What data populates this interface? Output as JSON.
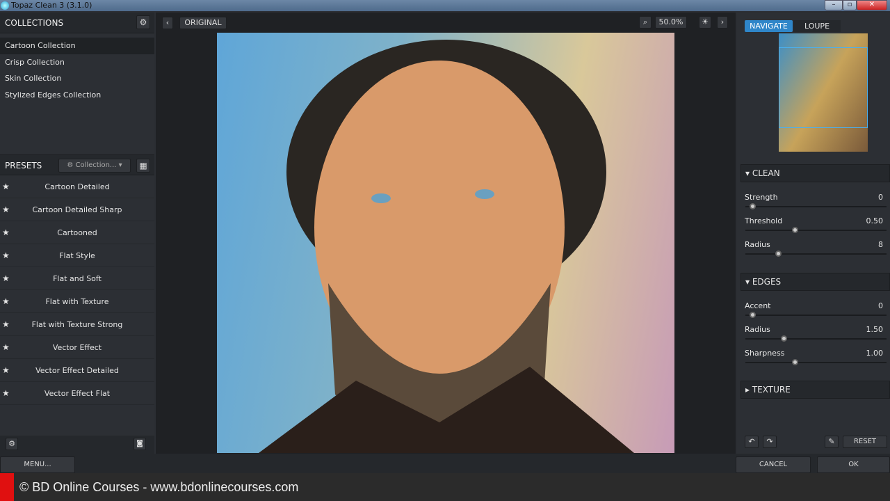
{
  "window": {
    "title": "Topaz Clean 3 (3.1.0)"
  },
  "collections": {
    "header": "COLLECTIONS",
    "items": [
      "Cartoon Collection",
      "Crisp Collection",
      "Skin Collection",
      "Stylized Edges Collection"
    ]
  },
  "presets": {
    "header": "PRESETS",
    "dropdown": "Collection...",
    "items": [
      "Cartoon Detailed",
      "Cartoon Detailed Sharp",
      "Cartooned",
      "Flat Style",
      "Flat and Soft",
      "Flat with Texture",
      "Flat with Texture Strong",
      "Vector Effect",
      "Vector Effect Detailed",
      "Vector Effect Flat"
    ]
  },
  "toolbar": {
    "original": "ORIGINAL",
    "zoom": "50.0%"
  },
  "navigator": {
    "tabs": [
      "NAVIGATE",
      "LOUPE"
    ],
    "active": "NAVIGATE"
  },
  "clean": {
    "title": "CLEAN",
    "sliders": [
      {
        "label": "Strength",
        "value": "0",
        "fraction": 0.05
      },
      {
        "label": "Threshold",
        "value": "0.50",
        "fraction": 0.35
      },
      {
        "label": "Radius",
        "value": "8",
        "fraction": 0.23
      }
    ]
  },
  "edges": {
    "title": "EDGES",
    "sliders": [
      {
        "label": "Accent",
        "value": "0",
        "fraction": 0.05
      },
      {
        "label": "Radius",
        "value": "1.50",
        "fraction": 0.27
      },
      {
        "label": "Sharpness",
        "value": "1.00",
        "fraction": 0.35
      }
    ]
  },
  "texture": {
    "title": "TEXTURE"
  },
  "buttons": {
    "reset": "RESET",
    "menu": "MENU...",
    "cancel": "CANCEL",
    "ok": "OK"
  },
  "footer": {
    "text": "© BD Online Courses - www.bdonlinecourses.com"
  },
  "colors": {
    "accent": "#2f86c9",
    "footer_red": "#e01010"
  }
}
